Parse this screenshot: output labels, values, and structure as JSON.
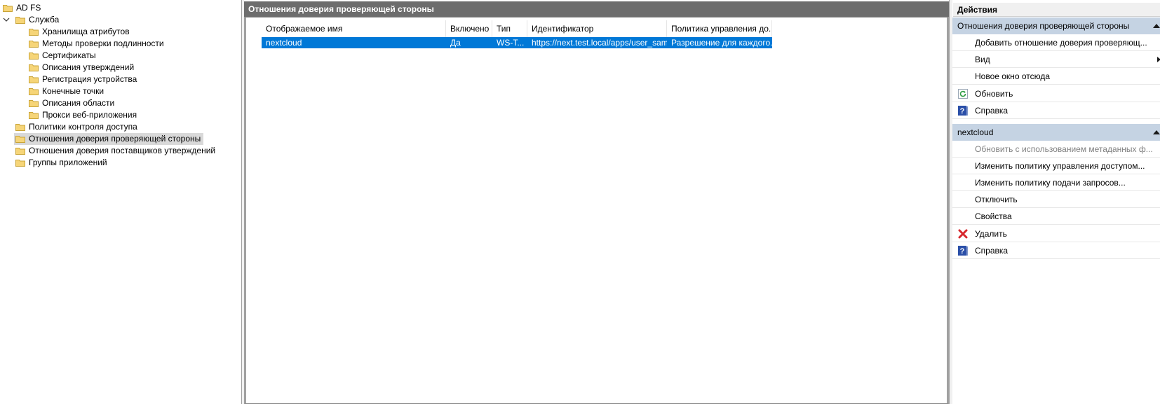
{
  "tree": {
    "root": "AD FS",
    "items": [
      {
        "label": "Служба",
        "level": 1
      },
      {
        "label": "Хранилища атрибутов",
        "level": 2
      },
      {
        "label": "Методы проверки подлинности",
        "level": 2
      },
      {
        "label": "Сертификаты",
        "level": 2
      },
      {
        "label": "Описания утверждений",
        "level": 2
      },
      {
        "label": "Регистрация устройства",
        "level": 2
      },
      {
        "label": "Конечные точки",
        "level": 2
      },
      {
        "label": "Описания области",
        "level": 2
      },
      {
        "label": "Прокси веб-приложения",
        "level": 2
      },
      {
        "label": "Политики контроля доступа",
        "level": 1
      },
      {
        "label": "Отношения доверия проверяющей стороны",
        "level": 1,
        "selected": true
      },
      {
        "label": "Отношения доверия поставщиков утверждений",
        "level": 1
      },
      {
        "label": "Группы приложений",
        "level": 1
      }
    ]
  },
  "center": {
    "title": "Отношения доверия проверяющей стороны",
    "columns": [
      "Отображаемое имя",
      "Включено",
      "Тип",
      "Идентификатор",
      "Политика управления до..."
    ],
    "rows": [
      [
        "nextcloud",
        "Да",
        "WS-T...",
        "https://next.test.local/apps/user_sam...",
        "Разрешение для каждого..."
      ]
    ]
  },
  "actions": {
    "title": "Действия",
    "section1": {
      "header": "Отношения доверия проверяющей стороны",
      "items": [
        {
          "label": "Добавить отношение доверия проверяющ...",
          "icon": ""
        },
        {
          "label": "Вид",
          "icon": "",
          "submenu": true
        },
        {
          "label": "Новое окно отсюда",
          "icon": ""
        },
        {
          "label": "Обновить",
          "icon": "refresh-icon"
        },
        {
          "label": "Справка",
          "icon": "help-icon"
        }
      ]
    },
    "section2": {
      "header": "nextcloud",
      "items": [
        {
          "label": "Обновить с использованием метаданных ф...",
          "icon": "",
          "disabled": true
        },
        {
          "label": "Изменить политику управления доступом...",
          "icon": ""
        },
        {
          "label": "Изменить политику подачи запросов...",
          "icon": ""
        },
        {
          "label": "Отключить",
          "icon": ""
        },
        {
          "label": "Свойства",
          "icon": ""
        },
        {
          "label": "Удалить",
          "icon": "delete-icon"
        },
        {
          "label": "Справка",
          "icon": "help-icon"
        }
      ]
    }
  },
  "colors": {
    "selection": "#0078d7",
    "section_header": "#c5d3e3",
    "title_bar": "#6d6d6d",
    "highlight": "#ffff33"
  }
}
